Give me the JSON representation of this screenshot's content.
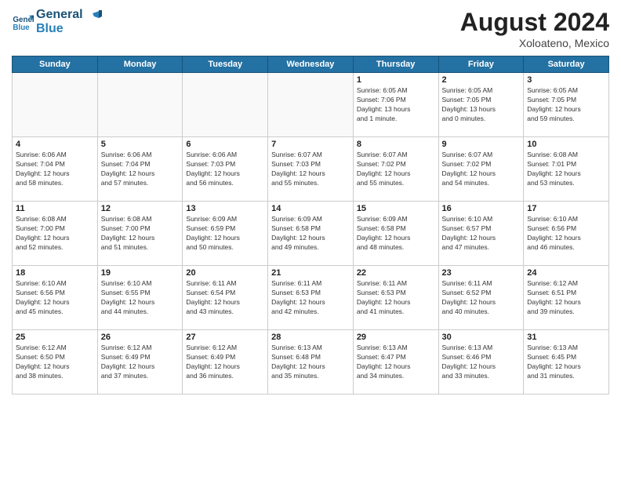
{
  "header": {
    "logo_line1": "General",
    "logo_line2": "Blue",
    "month_title": "August 2024",
    "location": "Xoloateno, Mexico"
  },
  "days_of_week": [
    "Sunday",
    "Monday",
    "Tuesday",
    "Wednesday",
    "Thursday",
    "Friday",
    "Saturday"
  ],
  "weeks": [
    [
      {
        "day": "",
        "info": ""
      },
      {
        "day": "",
        "info": ""
      },
      {
        "day": "",
        "info": ""
      },
      {
        "day": "",
        "info": ""
      },
      {
        "day": "1",
        "info": "Sunrise: 6:05 AM\nSunset: 7:06 PM\nDaylight: 13 hours\nand 1 minute."
      },
      {
        "day": "2",
        "info": "Sunrise: 6:05 AM\nSunset: 7:05 PM\nDaylight: 13 hours\nand 0 minutes."
      },
      {
        "day": "3",
        "info": "Sunrise: 6:05 AM\nSunset: 7:05 PM\nDaylight: 12 hours\nand 59 minutes."
      }
    ],
    [
      {
        "day": "4",
        "info": "Sunrise: 6:06 AM\nSunset: 7:04 PM\nDaylight: 12 hours\nand 58 minutes."
      },
      {
        "day": "5",
        "info": "Sunrise: 6:06 AM\nSunset: 7:04 PM\nDaylight: 12 hours\nand 57 minutes."
      },
      {
        "day": "6",
        "info": "Sunrise: 6:06 AM\nSunset: 7:03 PM\nDaylight: 12 hours\nand 56 minutes."
      },
      {
        "day": "7",
        "info": "Sunrise: 6:07 AM\nSunset: 7:03 PM\nDaylight: 12 hours\nand 55 minutes."
      },
      {
        "day": "8",
        "info": "Sunrise: 6:07 AM\nSunset: 7:02 PM\nDaylight: 12 hours\nand 55 minutes."
      },
      {
        "day": "9",
        "info": "Sunrise: 6:07 AM\nSunset: 7:02 PM\nDaylight: 12 hours\nand 54 minutes."
      },
      {
        "day": "10",
        "info": "Sunrise: 6:08 AM\nSunset: 7:01 PM\nDaylight: 12 hours\nand 53 minutes."
      }
    ],
    [
      {
        "day": "11",
        "info": "Sunrise: 6:08 AM\nSunset: 7:00 PM\nDaylight: 12 hours\nand 52 minutes."
      },
      {
        "day": "12",
        "info": "Sunrise: 6:08 AM\nSunset: 7:00 PM\nDaylight: 12 hours\nand 51 minutes."
      },
      {
        "day": "13",
        "info": "Sunrise: 6:09 AM\nSunset: 6:59 PM\nDaylight: 12 hours\nand 50 minutes."
      },
      {
        "day": "14",
        "info": "Sunrise: 6:09 AM\nSunset: 6:58 PM\nDaylight: 12 hours\nand 49 minutes."
      },
      {
        "day": "15",
        "info": "Sunrise: 6:09 AM\nSunset: 6:58 PM\nDaylight: 12 hours\nand 48 minutes."
      },
      {
        "day": "16",
        "info": "Sunrise: 6:10 AM\nSunset: 6:57 PM\nDaylight: 12 hours\nand 47 minutes."
      },
      {
        "day": "17",
        "info": "Sunrise: 6:10 AM\nSunset: 6:56 PM\nDaylight: 12 hours\nand 46 minutes."
      }
    ],
    [
      {
        "day": "18",
        "info": "Sunrise: 6:10 AM\nSunset: 6:56 PM\nDaylight: 12 hours\nand 45 minutes."
      },
      {
        "day": "19",
        "info": "Sunrise: 6:10 AM\nSunset: 6:55 PM\nDaylight: 12 hours\nand 44 minutes."
      },
      {
        "day": "20",
        "info": "Sunrise: 6:11 AM\nSunset: 6:54 PM\nDaylight: 12 hours\nand 43 minutes."
      },
      {
        "day": "21",
        "info": "Sunrise: 6:11 AM\nSunset: 6:53 PM\nDaylight: 12 hours\nand 42 minutes."
      },
      {
        "day": "22",
        "info": "Sunrise: 6:11 AM\nSunset: 6:53 PM\nDaylight: 12 hours\nand 41 minutes."
      },
      {
        "day": "23",
        "info": "Sunrise: 6:11 AM\nSunset: 6:52 PM\nDaylight: 12 hours\nand 40 minutes."
      },
      {
        "day": "24",
        "info": "Sunrise: 6:12 AM\nSunset: 6:51 PM\nDaylight: 12 hours\nand 39 minutes."
      }
    ],
    [
      {
        "day": "25",
        "info": "Sunrise: 6:12 AM\nSunset: 6:50 PM\nDaylight: 12 hours\nand 38 minutes."
      },
      {
        "day": "26",
        "info": "Sunrise: 6:12 AM\nSunset: 6:49 PM\nDaylight: 12 hours\nand 37 minutes."
      },
      {
        "day": "27",
        "info": "Sunrise: 6:12 AM\nSunset: 6:49 PM\nDaylight: 12 hours\nand 36 minutes."
      },
      {
        "day": "28",
        "info": "Sunrise: 6:13 AM\nSunset: 6:48 PM\nDaylight: 12 hours\nand 35 minutes."
      },
      {
        "day": "29",
        "info": "Sunrise: 6:13 AM\nSunset: 6:47 PM\nDaylight: 12 hours\nand 34 minutes."
      },
      {
        "day": "30",
        "info": "Sunrise: 6:13 AM\nSunset: 6:46 PM\nDaylight: 12 hours\nand 33 minutes."
      },
      {
        "day": "31",
        "info": "Sunrise: 6:13 AM\nSunset: 6:45 PM\nDaylight: 12 hours\nand 31 minutes."
      }
    ]
  ]
}
